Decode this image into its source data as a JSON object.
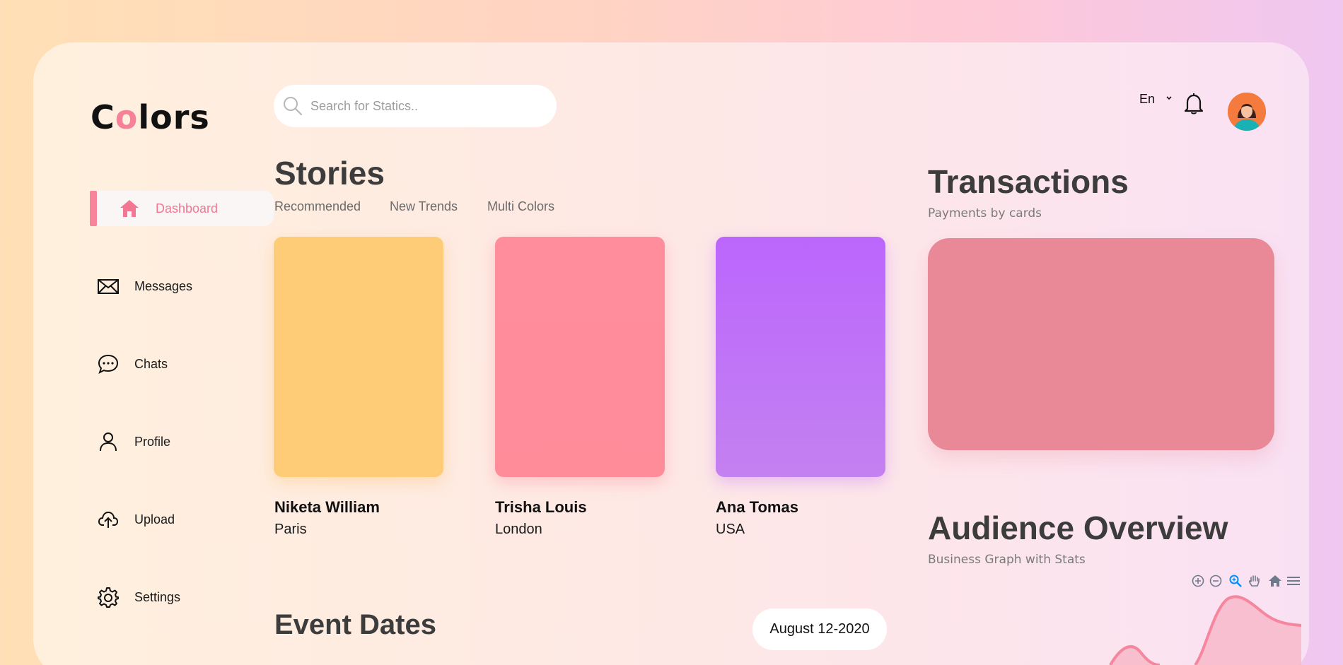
{
  "logo": {
    "prefix": "C",
    "accent": "o",
    "suffix": "lors"
  },
  "sidebar": {
    "items": [
      {
        "label": "Dashboard",
        "icon": "home-icon",
        "active": true
      },
      {
        "label": "Messages",
        "icon": "envelope-icon"
      },
      {
        "label": "Chats",
        "icon": "chat-bubble-icon"
      },
      {
        "label": "Profile",
        "icon": "user-icon"
      },
      {
        "label": "Upload",
        "icon": "cloud-upload-icon"
      },
      {
        "label": "Settings",
        "icon": "gear-icon"
      }
    ]
  },
  "search": {
    "placeholder": "Search for Statics.."
  },
  "header": {
    "language": "En"
  },
  "stories": {
    "title": "Stories",
    "tabs": [
      "Recommended",
      "New Trends",
      "Multi Colors"
    ],
    "cards": [
      {
        "name": "Niketa William",
        "place": "Paris",
        "color": "#fecb76"
      },
      {
        "name": "Trisha Louis",
        "place": "London",
        "color": "#ff8d9c"
      },
      {
        "name": "Ana Tomas",
        "place": "USA",
        "color": "#bb66fd"
      }
    ]
  },
  "events": {
    "title": "Event Dates",
    "date": "August 12-2020"
  },
  "transactions": {
    "title": "Transactions",
    "subtitle": "Payments by cards",
    "card_color": "#e98897"
  },
  "audience": {
    "title": "Audience Overview",
    "subtitle": "Business Graph with Stats"
  },
  "colors": {
    "accent": "#f7849a",
    "heading": "#3c3c3c"
  }
}
